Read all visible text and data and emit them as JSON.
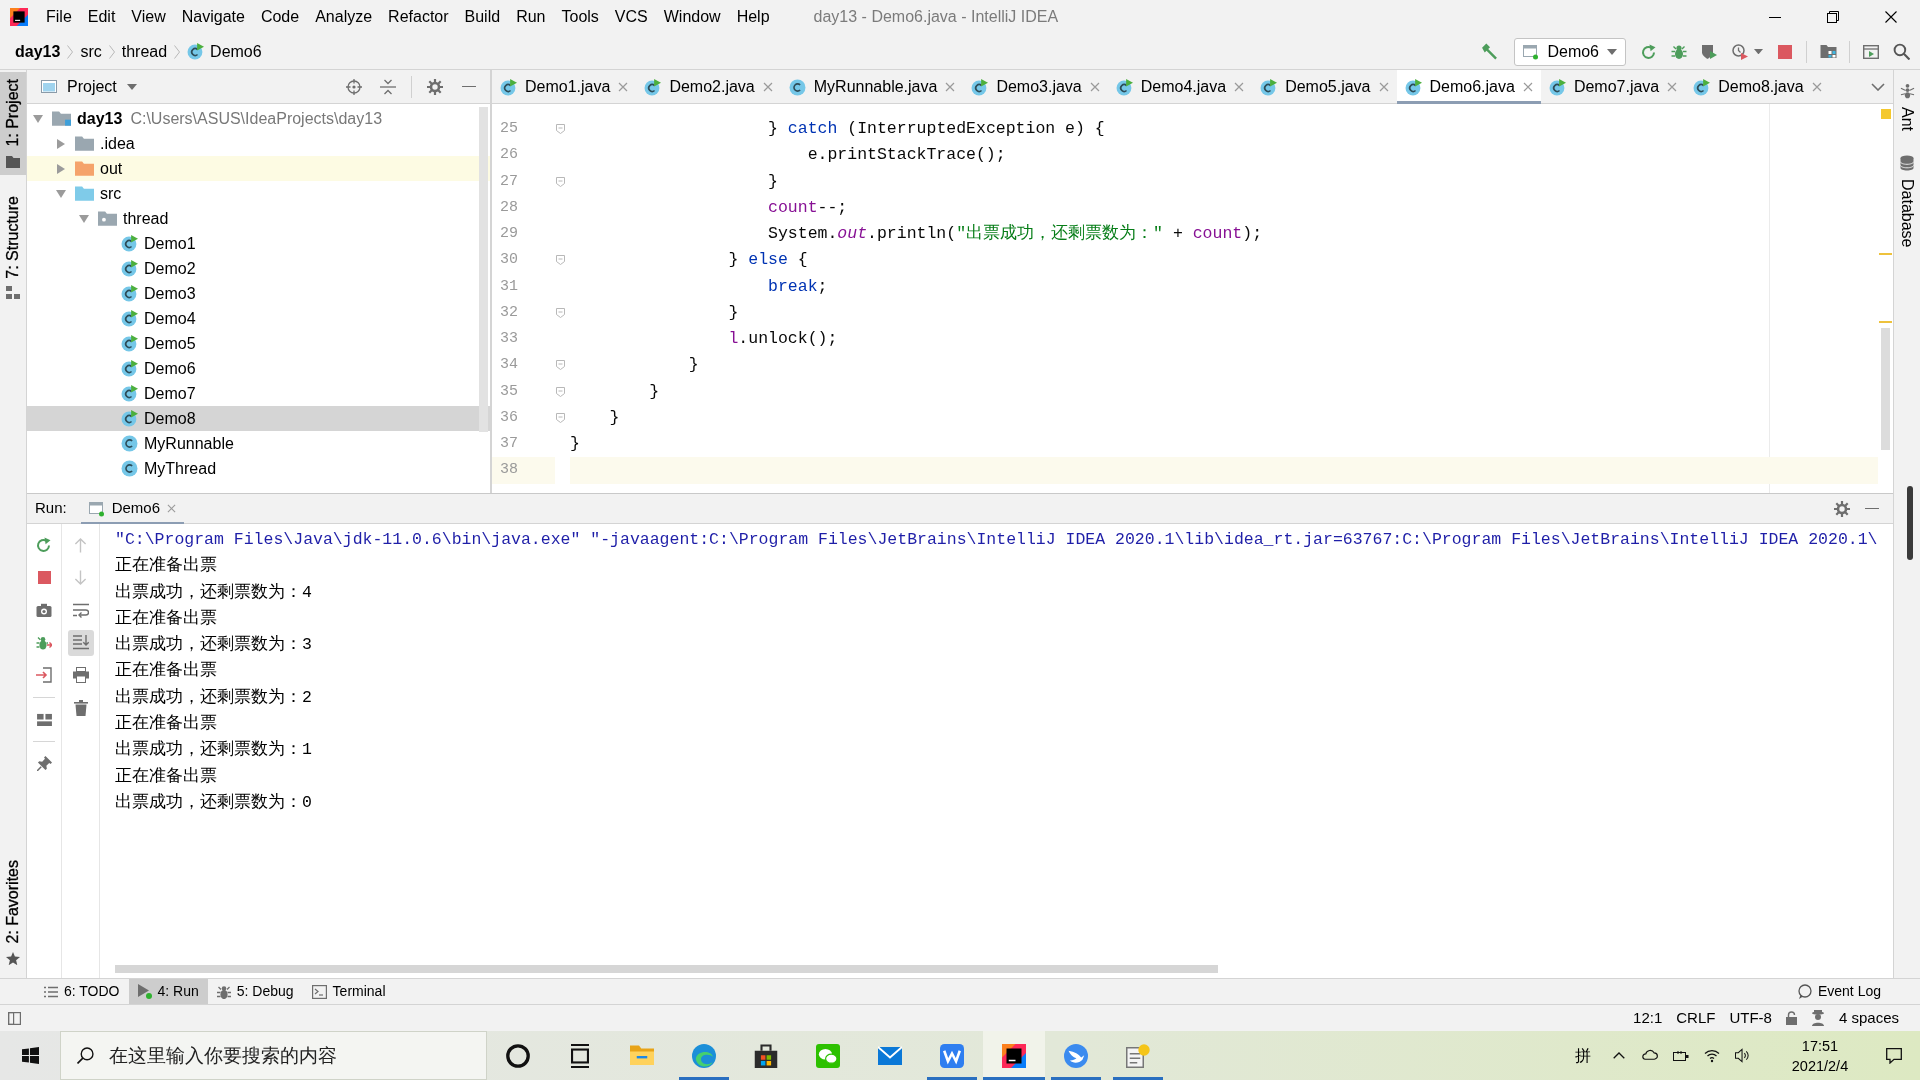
{
  "window": {
    "title": "day13 - Demo6.java - IntelliJ IDEA"
  },
  "menu": [
    "File",
    "Edit",
    "View",
    "Navigate",
    "Code",
    "Analyze",
    "Refactor",
    "Build",
    "Run",
    "Tools",
    "VCS",
    "Window",
    "Help"
  ],
  "breadcrumb": [
    {
      "label": "day13",
      "kind": "module"
    },
    {
      "label": "src",
      "kind": "folder"
    },
    {
      "label": "thread",
      "kind": "folder"
    },
    {
      "label": "Demo6",
      "kind": "class"
    }
  ],
  "run_config": {
    "label": "Demo6"
  },
  "left_strip": {
    "top": [
      {
        "label": "1: Project",
        "kind": "project",
        "selected": true
      },
      {
        "label": "7: Structure",
        "kind": "structure",
        "selected": false
      }
    ],
    "bottom": [
      {
        "label": "2: Favorites",
        "kind": "favorites",
        "selected": false
      }
    ]
  },
  "right_strip": [
    {
      "label": "Ant",
      "kind": "ant"
    },
    {
      "label": "Database",
      "kind": "database"
    }
  ],
  "project_panel": {
    "title": "Project",
    "tree": [
      {
        "label": "day13",
        "path": "C:\\Users\\ASUS\\IdeaProjects\\day13",
        "kind": "module",
        "expanded": true,
        "selected": false,
        "children": [
          {
            "label": ".idea",
            "kind": "folder",
            "expanded": false,
            "selected": false
          },
          {
            "label": "out",
            "kind": "excluded",
            "expanded": false,
            "selected": false
          },
          {
            "label": "src",
            "kind": "source",
            "expanded": true,
            "selected": false,
            "children": [
              {
                "label": "thread",
                "kind": "package",
                "expanded": true,
                "selected": false,
                "children": [
                  {
                    "label": "Demo1",
                    "kind": "class",
                    "runnable": true,
                    "selected": false
                  },
                  {
                    "label": "Demo2",
                    "kind": "class",
                    "runnable": true,
                    "selected": false
                  },
                  {
                    "label": "Demo3",
                    "kind": "class",
                    "runnable": true,
                    "selected": false
                  },
                  {
                    "label": "Demo4",
                    "kind": "class",
                    "runnable": true,
                    "selected": false
                  },
                  {
                    "label": "Demo5",
                    "kind": "class",
                    "runnable": true,
                    "selected": false
                  },
                  {
                    "label": "Demo6",
                    "kind": "class",
                    "runnable": true,
                    "selected": false
                  },
                  {
                    "label": "Demo7",
                    "kind": "class",
                    "runnable": true,
                    "selected": false
                  },
                  {
                    "label": "Demo8",
                    "kind": "class",
                    "runnable": true,
                    "selected": true
                  },
                  {
                    "label": "MyRunnable",
                    "kind": "class",
                    "runnable": false,
                    "selected": false
                  },
                  {
                    "label": "MyThread",
                    "kind": "class",
                    "runnable": false,
                    "selected": false
                  }
                ]
              }
            ]
          }
        ]
      }
    ]
  },
  "editor": {
    "tabs": [
      {
        "label": "Demo1.java",
        "runnable": true,
        "selected": false
      },
      {
        "label": "Demo2.java",
        "runnable": true,
        "selected": false
      },
      {
        "label": "MyRunnable.java",
        "runnable": false,
        "selected": false
      },
      {
        "label": "Demo3.java",
        "runnable": true,
        "selected": false
      },
      {
        "label": "Demo4.java",
        "runnable": true,
        "selected": false
      },
      {
        "label": "Demo5.java",
        "runnable": true,
        "selected": false
      },
      {
        "label": "Demo6.java",
        "runnable": true,
        "selected": true
      },
      {
        "label": "Demo7.java",
        "runnable": true,
        "selected": false
      },
      {
        "label": "Demo8.java",
        "runnable": true,
        "selected": false
      }
    ],
    "lines": [
      {
        "number": "25",
        "fold": true,
        "current": false,
        "tokens": [
          {
            "text": "                    } ",
            "kind": "plain"
          },
          {
            "text": "catch",
            "kind": "keyword"
          },
          {
            "text": " (InterruptedException e) {",
            "kind": "plain"
          }
        ]
      },
      {
        "number": "26",
        "fold": false,
        "current": false,
        "tokens": [
          {
            "text": "                        e.printStackTrace();",
            "kind": "plain"
          }
        ]
      },
      {
        "number": "27",
        "fold": true,
        "current": false,
        "tokens": [
          {
            "text": "                    }",
            "kind": "plain"
          }
        ]
      },
      {
        "number": "28",
        "fold": false,
        "current": false,
        "tokens": [
          {
            "text": "                    count",
            "kind": "field"
          },
          {
            "text": "--;",
            "kind": "plain"
          }
        ]
      },
      {
        "number": "29",
        "fold": false,
        "current": false,
        "tokens": [
          {
            "text": "                    System.",
            "kind": "plain"
          },
          {
            "text": "out",
            "kind": "static"
          },
          {
            "text": ".println(",
            "kind": "plain"
          },
          {
            "text": "\"出票成功，还剩票数为：\"",
            "kind": "string"
          },
          {
            "text": " + ",
            "kind": "plain"
          },
          {
            "text": "count",
            "kind": "field"
          },
          {
            "text": ");",
            "kind": "plain"
          }
        ]
      },
      {
        "number": "30",
        "fold": true,
        "current": false,
        "tokens": [
          {
            "text": "                } ",
            "kind": "plain"
          },
          {
            "text": "else",
            "kind": "keyword"
          },
          {
            "text": " {",
            "kind": "plain"
          }
        ]
      },
      {
        "number": "31",
        "fold": false,
        "current": false,
        "tokens": [
          {
            "text": "                    break",
            "kind": "keyword"
          },
          {
            "text": ";",
            "kind": "plain"
          }
        ]
      },
      {
        "number": "32",
        "fold": true,
        "current": false,
        "tokens": [
          {
            "text": "                }",
            "kind": "plain"
          }
        ]
      },
      {
        "number": "33",
        "fold": false,
        "current": false,
        "tokens": [
          {
            "text": "                l",
            "kind": "field"
          },
          {
            "text": ".unlock();",
            "kind": "plain"
          }
        ]
      },
      {
        "number": "34",
        "fold": true,
        "current": false,
        "tokens": [
          {
            "text": "            }",
            "kind": "plain"
          }
        ]
      },
      {
        "number": "35",
        "fold": true,
        "current": false,
        "tokens": [
          {
            "text": "        }",
            "kind": "plain"
          }
        ]
      },
      {
        "number": "36",
        "fold": true,
        "current": false,
        "tokens": [
          {
            "text": "    }",
            "kind": "plain"
          }
        ]
      },
      {
        "number": "37",
        "fold": false,
        "current": false,
        "tokens": [
          {
            "text": "}",
            "kind": "plain"
          }
        ]
      },
      {
        "number": "38",
        "fold": false,
        "current": true
      }
    ]
  },
  "run_panel": {
    "title": "Run:",
    "tab": {
      "label": "Demo6"
    },
    "console": [
      {
        "kind": "command",
        "text": "\"C:\\Program Files\\Java\\jdk-11.0.6\\bin\\java.exe\" \"-javaagent:C:\\Program Files\\JetBrains\\IntelliJ IDEA 2020.1\\lib\\idea_rt.jar=63767:C:\\Program Files\\JetBrains\\IntelliJ IDEA 2020.1\\"
      },
      {
        "kind": "output",
        "text": "正在准备出票"
      },
      {
        "kind": "output",
        "text": "出票成功，还剩票数为：4"
      },
      {
        "kind": "output",
        "text": "正在准备出票"
      },
      {
        "kind": "output",
        "text": "出票成功，还剩票数为：3"
      },
      {
        "kind": "output",
        "text": "正在准备出票"
      },
      {
        "kind": "output",
        "text": "出票成功，还剩票数为：2"
      },
      {
        "kind": "output",
        "text": "正在准备出票"
      },
      {
        "kind": "output",
        "text": "出票成功，还剩票数为：1"
      },
      {
        "kind": "output",
        "text": "正在准备出票"
      },
      {
        "kind": "output",
        "text": "出票成功，还剩票数为：0"
      }
    ]
  },
  "tool_buttons": [
    {
      "label": "6: TODO",
      "kind": "todo",
      "selected": false
    },
    {
      "label": "4: Run",
      "kind": "run",
      "selected": true
    },
    {
      "label": "5: Debug",
      "kind": "debug",
      "selected": false
    },
    {
      "label": "Terminal",
      "kind": "terminal",
      "selected": false
    }
  ],
  "event_log": {
    "label": "Event Log"
  },
  "status_bar": {
    "position": "12:1",
    "line_separator": "CRLF",
    "encoding": "UTF-8",
    "indent": "4 spaces"
  },
  "taskbar": {
    "search_placeholder": "在这里输入你要搜索的内容",
    "apps": [
      {
        "kind": "ring",
        "running": false,
        "active": false
      },
      {
        "kind": "task-view",
        "running": false,
        "active": false
      },
      {
        "kind": "folder",
        "running": false,
        "active": false
      },
      {
        "kind": "browser",
        "running": true,
        "active": false
      },
      {
        "kind": "store",
        "running": false,
        "active": false
      },
      {
        "kind": "chat",
        "running": false,
        "active": false
      },
      {
        "kind": "mail",
        "running": false,
        "active": false
      },
      {
        "kind": "office",
        "running": true,
        "active": false
      },
      {
        "kind": "ide",
        "running": true,
        "active": true
      },
      {
        "kind": "bird",
        "running": true,
        "active": false
      },
      {
        "kind": "notes",
        "running": true,
        "active": false
      }
    ],
    "input_method": "拼",
    "time": "17:51",
    "date": "2021/2/4"
  }
}
